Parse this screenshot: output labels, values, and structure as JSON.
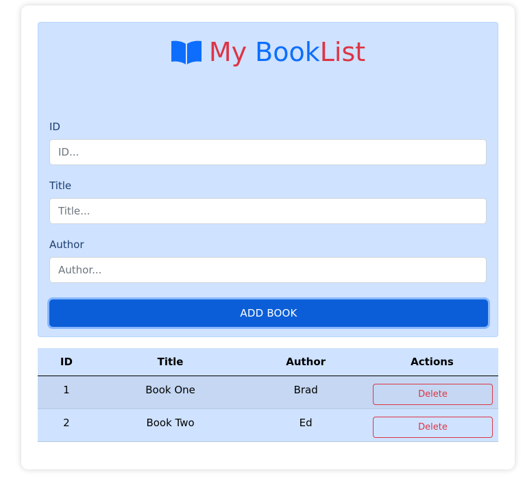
{
  "app": {
    "title_part1": "My ",
    "title_part2": "Book",
    "title_part3": "List",
    "icon": "open-book-icon",
    "colors": {
      "red": "#dc3545",
      "blue": "#0d6efd",
      "panel": "#cfe2ff",
      "button": "#0b5ed7"
    }
  },
  "form": {
    "fields": [
      {
        "label": "ID",
        "placeholder": "ID...",
        "value": ""
      },
      {
        "label": "Title",
        "placeholder": "Title...",
        "value": ""
      },
      {
        "label": "Author",
        "placeholder": "Author...",
        "value": ""
      }
    ],
    "submit_label": "ADD BOOK"
  },
  "table": {
    "headers": [
      "ID",
      "Title",
      "Author",
      "Actions"
    ],
    "rows": [
      {
        "id": "1",
        "title": "Book One",
        "author": "Brad",
        "action": "Delete"
      },
      {
        "id": "2",
        "title": "Book Two",
        "author": "Ed",
        "action": "Delete"
      }
    ]
  }
}
